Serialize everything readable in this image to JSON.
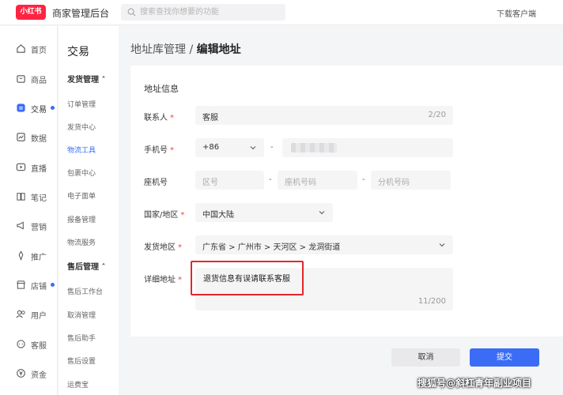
{
  "header": {
    "logo_text": "小红书",
    "app_title": "商家管理后台",
    "search_placeholder": "搜索查找你想要的功能",
    "download_label": "下载客户端"
  },
  "nav": {
    "items": [
      {
        "label": "首页",
        "icon": "home-icon"
      },
      {
        "label": "商品",
        "icon": "product-icon"
      },
      {
        "label": "交易",
        "icon": "trade-icon",
        "active": true
      },
      {
        "label": "数据",
        "icon": "chart-icon"
      },
      {
        "label": "直播",
        "icon": "live-icon"
      },
      {
        "label": "笔记",
        "icon": "note-icon"
      },
      {
        "label": "营销",
        "icon": "megaphone-icon"
      },
      {
        "label": "推广",
        "icon": "promote-icon"
      },
      {
        "label": "店铺",
        "icon": "store-icon"
      },
      {
        "label": "用户",
        "icon": "user-icon"
      },
      {
        "label": "客服",
        "icon": "service-icon"
      },
      {
        "label": "资金",
        "icon": "money-icon"
      }
    ]
  },
  "subnav": {
    "title": "交易",
    "group1": "发货管理 ˄",
    "group1_items": [
      "订单管理",
      "发货中心",
      "物流工具",
      "包裹中心",
      "电子面单",
      "报备管理",
      "物流服务"
    ],
    "group2": "售后管理 ˄",
    "group2_items": [
      "售后工作台",
      "取消管理",
      "售后助手",
      "售后设置",
      "运费宝"
    ]
  },
  "breadcrumb": {
    "parent": "地址库管理 / ",
    "current": "编辑地址"
  },
  "form": {
    "section_title": "地址信息",
    "contact_label": "联系人",
    "contact_value": "客服",
    "contact_count": "2/20",
    "phone_label": "手机号",
    "phone_code": "+86",
    "dash": "-",
    "landline_label": "座机号",
    "area_code_placeholder": "区号",
    "landline_placeholder": "座机号码",
    "extension_placeholder": "分机号码",
    "country_label": "国家/地区",
    "country_value": "中国大陆",
    "region_label": "发货地区",
    "region_value": "广东省 > 广州市 > 天河区 > 龙洞街道",
    "address_label": "详细地址",
    "address_value": "退货信息有误请联系客服",
    "address_count": "11/200",
    "required_mark": "*"
  },
  "actions": {
    "cancel": "取消",
    "submit": "提交"
  },
  "watermark": "搜狐号@斜杠青年副业项目",
  "colors": {
    "brand": "#ff2442",
    "accent": "#3b6cf6",
    "highlight": "#e6252b"
  }
}
